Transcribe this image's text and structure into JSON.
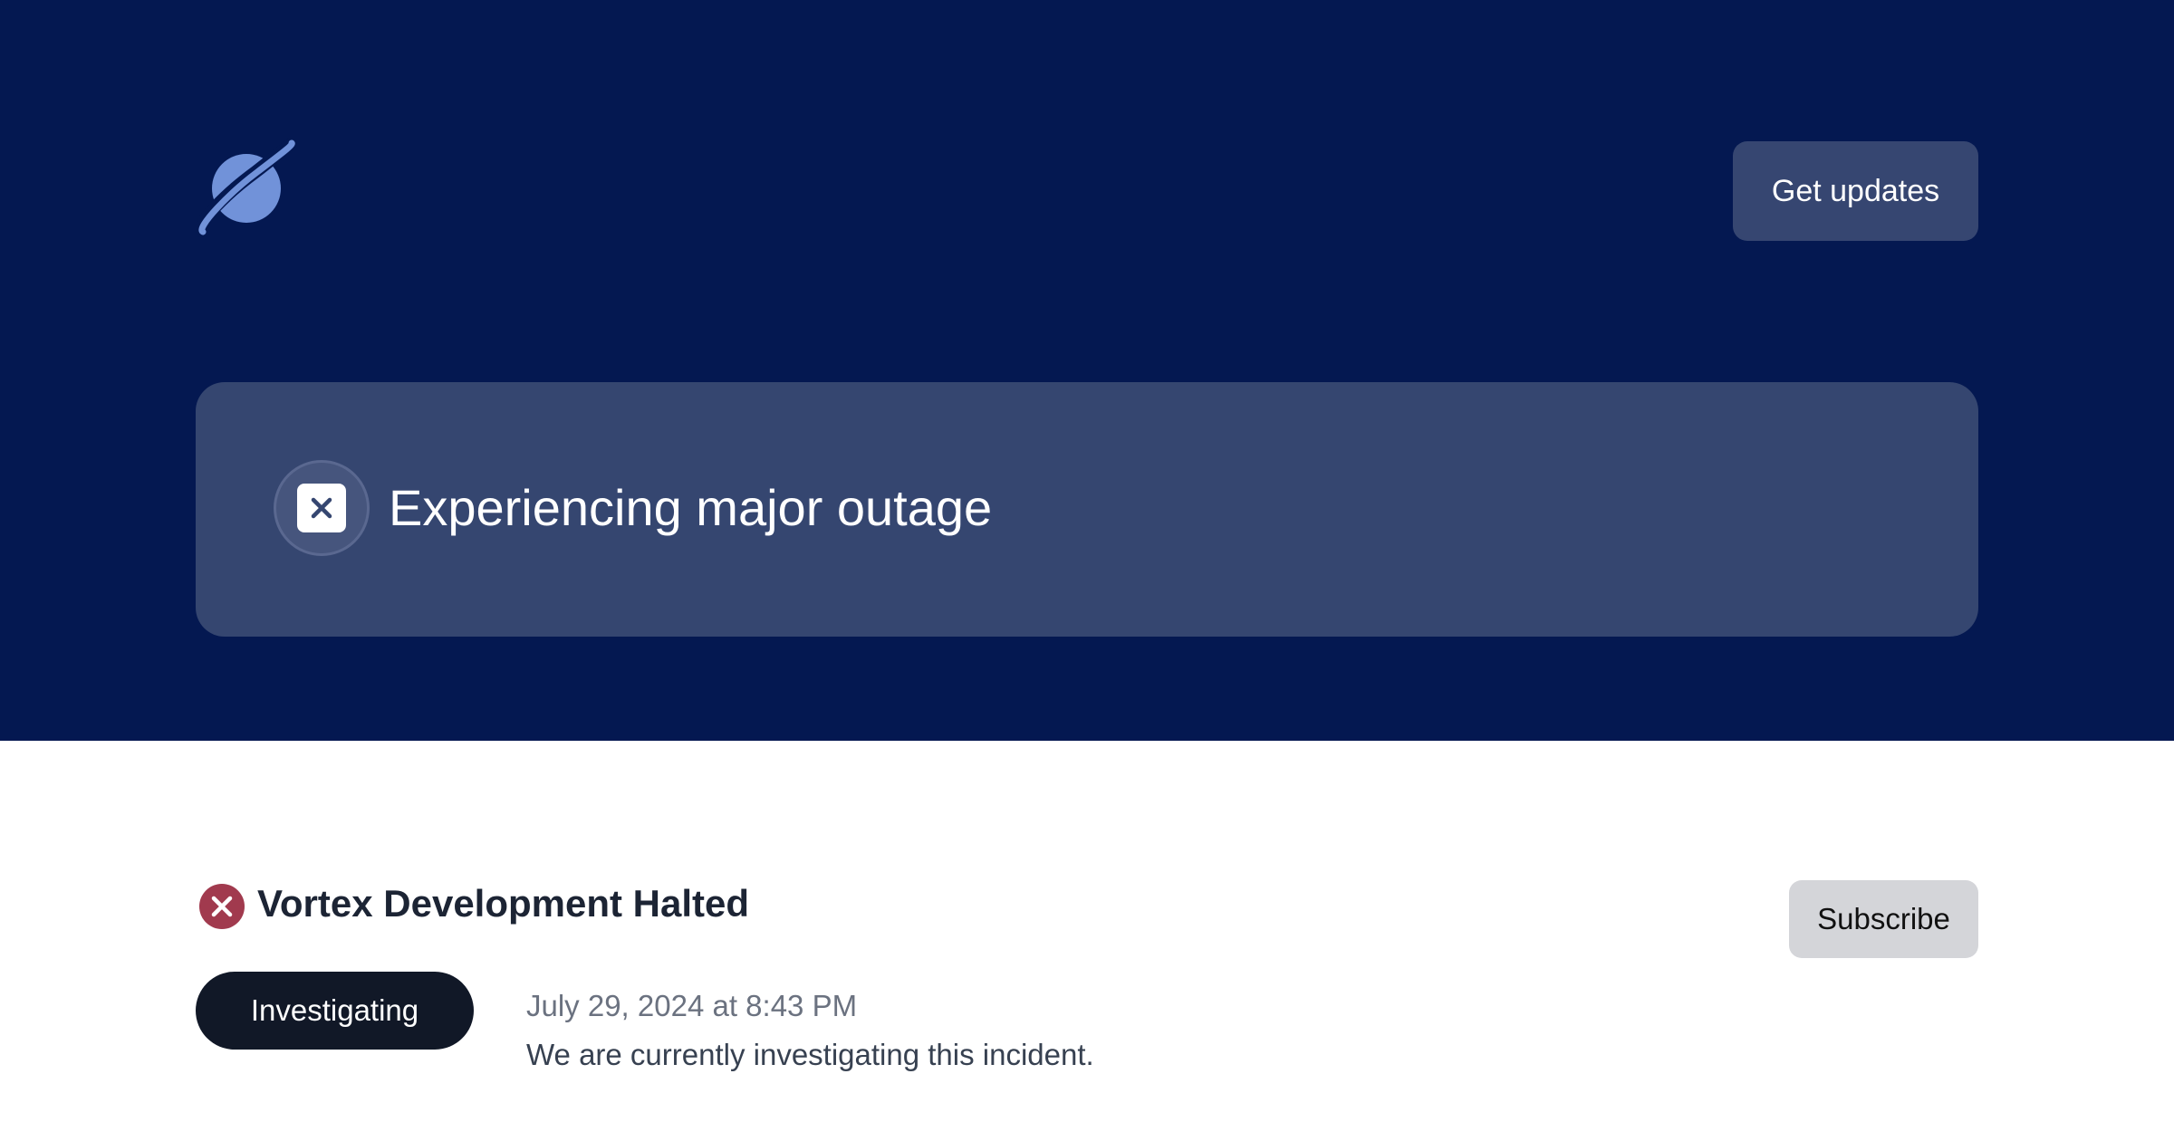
{
  "header": {
    "logo_icon": "planet-icon",
    "get_updates_label": "Get updates"
  },
  "status": {
    "icon": "x-square-icon",
    "text": "Experiencing major outage"
  },
  "incident": {
    "status_icon": "x-circle-icon",
    "title": "Vortex Development Halted",
    "subscribe_label": "Subscribe",
    "update": {
      "stage": "Investigating",
      "timestamp": "July 29, 2024 at 8:43 PM",
      "message": "We are currently investigating this incident."
    }
  },
  "colors": {
    "hero_bg": "#041851",
    "banner_bg": "#354670",
    "logo": "#7192d9",
    "outage_red": "#a13a4e",
    "pill_bg": "#111827"
  }
}
